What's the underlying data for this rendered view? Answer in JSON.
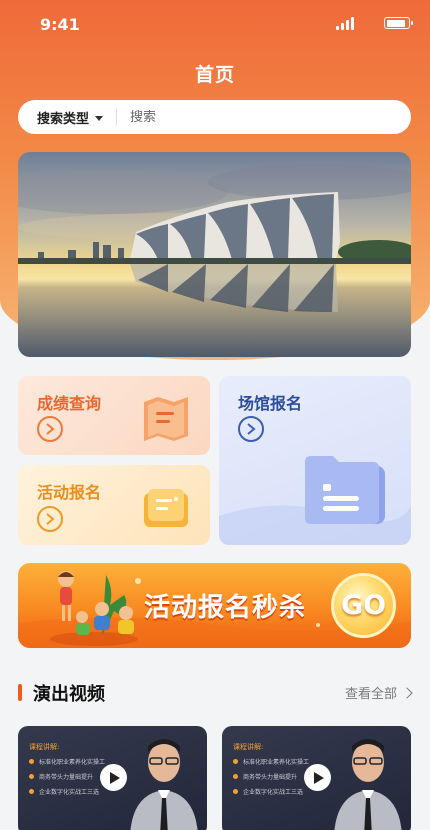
{
  "status_bar": {
    "time": "9:41",
    "signal_icon": "signal-icon",
    "battery_icon": "battery-icon"
  },
  "header": {
    "title": "首页"
  },
  "search": {
    "type_label": "搜索类型",
    "placeholder": "搜索"
  },
  "quick_entries": [
    {
      "label": "成绩查询",
      "icon": "score-map-icon",
      "accent": "#e8692f"
    },
    {
      "label": "活动报名",
      "icon": "activity-card-icon",
      "accent": "#e88f20"
    },
    {
      "label": "场馆报名",
      "icon": "venue-folder-icon",
      "accent": "#2c4e9a"
    }
  ],
  "promo": {
    "text": "活动报名秒杀",
    "button": "GO"
  },
  "videos_section": {
    "title": "演出视频",
    "view_all": "查看全部",
    "items": [
      {
        "heading": "课程讲解:",
        "lines": [
          "标准化职业素养化实操工",
          "商务带头力量础提升",
          "企业数字化实战工三选"
        ]
      },
      {
        "heading": "课程讲解:",
        "lines": [
          "标准化职业素养化实操工",
          "商务带头力量础提升",
          "企业数字化实战工三选"
        ]
      }
    ]
  }
}
